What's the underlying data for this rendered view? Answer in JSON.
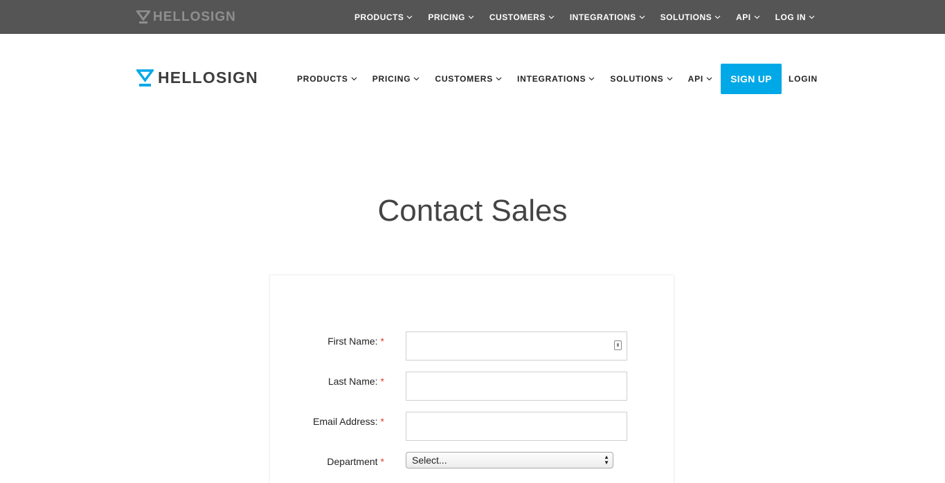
{
  "topbar": {
    "logo_text": "HELLOSIGN",
    "nav": [
      "PRODUCTS",
      "PRICING",
      "CUSTOMERS",
      "INTEGRATIONS",
      "SOLUTIONS",
      "API",
      "LOG IN"
    ]
  },
  "header": {
    "logo_text": "HELLOSIGN",
    "nav": [
      "PRODUCTS",
      "PRICING",
      "CUSTOMERS",
      "INTEGRATIONS",
      "SOLUTIONS",
      "API"
    ],
    "signup_label": "SIGN UP",
    "login_label": "LOGIN",
    "accent_color": "#00a8e8"
  },
  "page_title": "Contact Sales",
  "form": {
    "required_mark": "*",
    "first_name": {
      "label": "First Name:",
      "value": ""
    },
    "last_name": {
      "label": "Last Name:",
      "value": ""
    },
    "email": {
      "label": "Email Address:",
      "value": ""
    },
    "department": {
      "label": "Department",
      "selected": "Select..."
    }
  }
}
